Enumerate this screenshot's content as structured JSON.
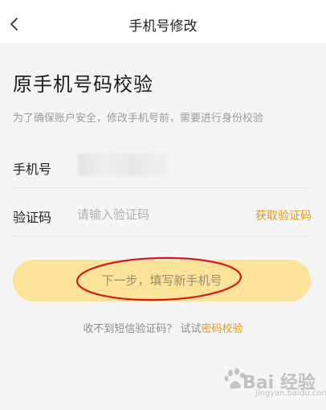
{
  "nav": {
    "title": "手机号修改",
    "back_icon": "chevron-left-icon"
  },
  "main": {
    "heading": "原手机号码校验",
    "subtitle": "为了确保账户安全，修改手机号前，需要进行身份校验",
    "phone_label": "手机号",
    "phone_value": "",
    "code_label": "验证码",
    "code_placeholder": "请输入验证码",
    "get_code_label": "获取验证码",
    "next_button_label": "下一步，填写新手机号",
    "help_text": "收不到短信验证码？ 试试",
    "help_link": "密码校验"
  },
  "watermark": {
    "brand": "Bai 经验",
    "sub": "jingyan.baidu.com"
  },
  "colors": {
    "accent": "#e39a12",
    "button_bg": "#fbe39a",
    "annotation_red": "#d81a1a"
  }
}
